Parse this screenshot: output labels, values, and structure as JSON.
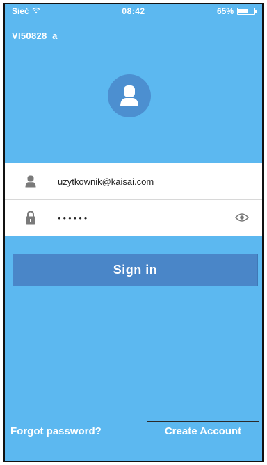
{
  "status_bar": {
    "carrier": "Sieć",
    "time": "08:42",
    "battery": "65%",
    "battery_level": 0.65
  },
  "device_name": "VI50828_a",
  "login": {
    "username": "uzytkownik@kaisai.com",
    "password_masked": "••••••"
  },
  "buttons": {
    "sign_in": "Sign in",
    "forgot_password": "Forgot password?",
    "create_account": "Create Account"
  },
  "icons": {
    "wifi": "wifi-icon",
    "avatar": "user-avatar-icon",
    "user": "user-icon",
    "lock": "lock-icon",
    "eye": "eye-icon"
  },
  "colors": {
    "background": "#5cb8f0",
    "avatar_circle": "#4c8fd0",
    "sign_in_button": "#4a86c8",
    "field_background": "#ffffff"
  }
}
